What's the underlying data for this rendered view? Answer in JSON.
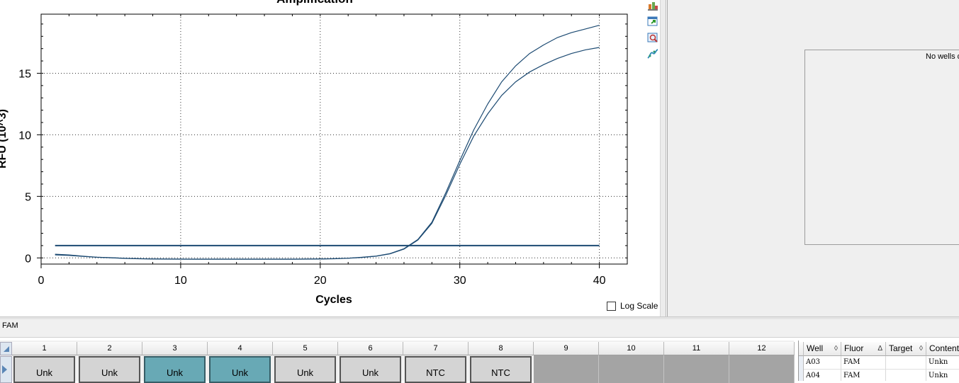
{
  "chart": {
    "title": "Amplification",
    "ylabel": "RFU (10^3)",
    "xlabel": "Cycles",
    "log_scale_label": "Log Scale",
    "log_scale_checked": false
  },
  "chart_data": {
    "type": "line",
    "title": "Amplification",
    "xlabel": "Cycles",
    "ylabel": "RFU (10^3)",
    "xlim": [
      0,
      42
    ],
    "ylim": [
      -0.5,
      19.8
    ],
    "xticks": [
      0,
      10,
      20,
      30,
      40
    ],
    "yticks": [
      0,
      5,
      10,
      15
    ],
    "grid": true,
    "series": [
      {
        "color": "#1c4a72",
        "x": [
          1,
          2,
          3,
          4,
          5,
          6,
          7,
          8,
          9,
          10,
          11,
          12,
          13,
          14,
          15,
          16,
          17,
          18,
          19,
          20,
          21,
          22,
          23,
          24,
          25,
          26,
          27,
          28,
          29,
          30,
          31,
          32,
          33,
          34,
          35,
          36,
          37,
          38,
          39,
          40
        ],
        "values": [
          0.3,
          0.24,
          0.14,
          0.06,
          0.02,
          -0.03,
          -0.06,
          -0.08,
          -0.09,
          -0.1,
          -0.1,
          -0.1,
          -0.1,
          -0.1,
          -0.1,
          -0.1,
          -0.1,
          -0.1,
          -0.09,
          -0.08,
          -0.06,
          -0.02,
          0.05,
          0.15,
          0.35,
          0.75,
          1.5,
          2.9,
          5.3,
          7.9,
          10.4,
          12.5,
          14.3,
          15.6,
          16.6,
          17.3,
          17.9,
          18.3,
          18.6,
          18.9
        ]
      },
      {
        "color": "#1c4a72",
        "x": [
          1,
          2,
          3,
          4,
          5,
          6,
          7,
          8,
          9,
          10,
          11,
          12,
          13,
          14,
          15,
          16,
          17,
          18,
          19,
          20,
          21,
          22,
          23,
          24,
          25,
          26,
          27,
          28,
          29,
          30,
          31,
          32,
          33,
          34,
          35,
          36,
          37,
          38,
          39,
          40
        ],
        "values": [
          0.25,
          0.2,
          0.12,
          0.05,
          0.01,
          -0.04,
          -0.07,
          -0.09,
          -0.1,
          -0.1,
          -0.11,
          -0.11,
          -0.11,
          -0.11,
          -0.11,
          -0.11,
          -0.11,
          -0.11,
          -0.1,
          -0.09,
          -0.07,
          -0.03,
          0.04,
          0.14,
          0.33,
          0.72,
          1.45,
          2.8,
          5.1,
          7.6,
          9.9,
          11.7,
          13.2,
          14.3,
          15.1,
          15.7,
          16.2,
          16.6,
          16.9,
          17.1
        ]
      },
      {
        "color": "#1c4a72",
        "x": [
          1,
          40
        ],
        "values": [
          1.0,
          1.0
        ]
      }
    ]
  },
  "toolbar_icons": [
    "copy-icon",
    "export-icon",
    "zoom-icon",
    "chart-settings-icon"
  ],
  "right_panel": {
    "message": "No wells d"
  },
  "fluor_bar": {
    "label": "FAM"
  },
  "plate": {
    "columns": [
      "1",
      "2",
      "3",
      "4",
      "5",
      "6",
      "7",
      "8",
      "9",
      "10",
      "11",
      "12"
    ],
    "wells": [
      {
        "label": "Unk",
        "state": "normal"
      },
      {
        "label": "Unk",
        "state": "normal"
      },
      {
        "label": "Unk",
        "state": "selected"
      },
      {
        "label": "Unk",
        "state": "selected"
      },
      {
        "label": "Unk",
        "state": "normal"
      },
      {
        "label": "Unk",
        "state": "normal"
      },
      {
        "label": "NTC",
        "state": "normal"
      },
      {
        "label": "NTC",
        "state": "normal"
      },
      {
        "label": "",
        "state": "empty"
      },
      {
        "label": "",
        "state": "empty"
      },
      {
        "label": "",
        "state": "empty"
      },
      {
        "label": "",
        "state": "empty"
      }
    ]
  },
  "well_table": {
    "headers": [
      {
        "label": "Well",
        "sort": "◊"
      },
      {
        "label": "Fluor",
        "sort": "Δ"
      },
      {
        "label": "Target",
        "sort": "◊"
      },
      {
        "label": "Content",
        "sort": ""
      }
    ],
    "rows": [
      [
        "A03",
        "FAM",
        "",
        "Unkn"
      ],
      [
        "A04",
        "FAM",
        "",
        "Unkn"
      ]
    ]
  }
}
